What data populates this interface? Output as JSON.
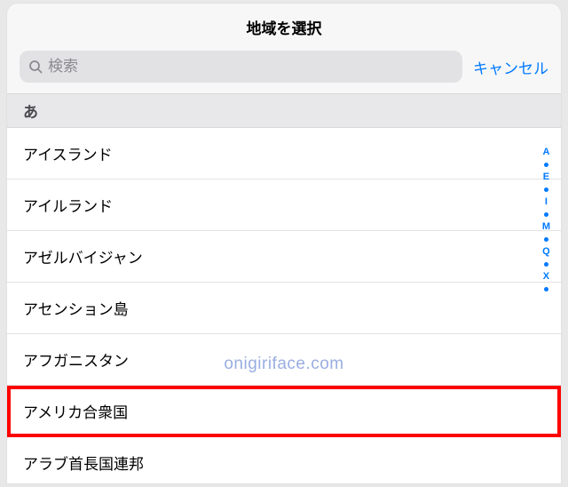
{
  "header": {
    "title": "地域を選択"
  },
  "search": {
    "placeholder": "検索",
    "cancel_label": "キャンセル"
  },
  "section": {
    "label": "あ"
  },
  "items": [
    {
      "label": "アイスランド",
      "highlighted": false
    },
    {
      "label": "アイルランド",
      "highlighted": false
    },
    {
      "label": "アゼルバイジャン",
      "highlighted": false
    },
    {
      "label": "アセンション島",
      "highlighted": false
    },
    {
      "label": "アフガニスタン",
      "highlighted": false
    },
    {
      "label": "アメリカ合衆国",
      "highlighted": true
    },
    {
      "label": "アラブ首長国連邦",
      "highlighted": false
    }
  ],
  "index_bar": [
    "A",
    "E",
    "I",
    "M",
    "Q",
    "X"
  ],
  "watermark": "onigiriface.com",
  "colors": {
    "accent": "#007aff",
    "highlight_border": "#ff0000"
  }
}
